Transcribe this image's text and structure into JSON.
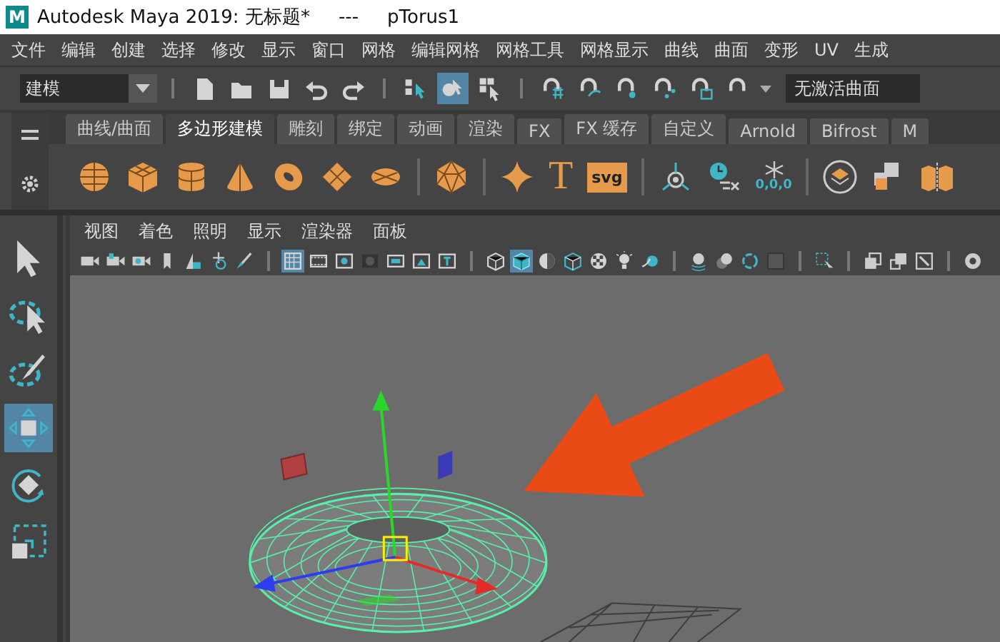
{
  "window": {
    "logo": "M",
    "title": "Autodesk Maya 2019: 无标题*",
    "separator": "---",
    "object": "pTorus1"
  },
  "menu": [
    "文件",
    "编辑",
    "创建",
    "选择",
    "修改",
    "显示",
    "窗口",
    "网格",
    "编辑网格",
    "网格工具",
    "网格显示",
    "曲线",
    "曲面",
    "变形",
    "UV",
    "生成"
  ],
  "toolbar": {
    "mode": "建模",
    "selection_masks": [
      {
        "selected": false
      },
      {
        "selected": true
      },
      {
        "selected": false
      }
    ],
    "live_surface": "无激活曲面"
  },
  "shelf": {
    "tabs": [
      {
        "label": "曲线/曲面",
        "selected": false
      },
      {
        "label": "多边形建模",
        "selected": true
      },
      {
        "label": "雕刻",
        "selected": false
      },
      {
        "label": "绑定",
        "selected": false
      },
      {
        "label": "动画",
        "selected": false
      },
      {
        "label": "渲染",
        "selected": false
      },
      {
        "label": "FX",
        "selected": false
      },
      {
        "label": "FX 缓存",
        "selected": false
      },
      {
        "label": "自定义",
        "selected": false
      },
      {
        "label": "Arnold",
        "selected": false
      },
      {
        "label": "Bifrost",
        "selected": false
      },
      {
        "label": "M",
        "selected": false
      }
    ],
    "text_tool": "T",
    "svg_tool": "svg",
    "freeze_label": "0,0,0"
  },
  "tools": [
    {
      "selected": false
    },
    {
      "selected": false
    },
    {
      "selected": false
    },
    {
      "selected": true
    },
    {
      "selected": false
    },
    {
      "selected": false
    }
  ],
  "viewport": {
    "menu": [
      "视图",
      "着色",
      "照明",
      "显示",
      "渲染器",
      "面板"
    ],
    "toggles": [
      {
        "selected": true
      },
      {
        "selected": false
      },
      {
        "selected": false
      },
      {
        "selected": false
      },
      {
        "selected": false
      },
      {
        "selected": false
      },
      {
        "selected": false
      }
    ],
    "shading": [
      {
        "selected": false
      },
      {
        "selected": true
      },
      {
        "selected": false
      },
      {
        "selected": false
      },
      {
        "selected": false
      },
      {
        "selected": false
      },
      {
        "selected": false
      }
    ]
  }
}
